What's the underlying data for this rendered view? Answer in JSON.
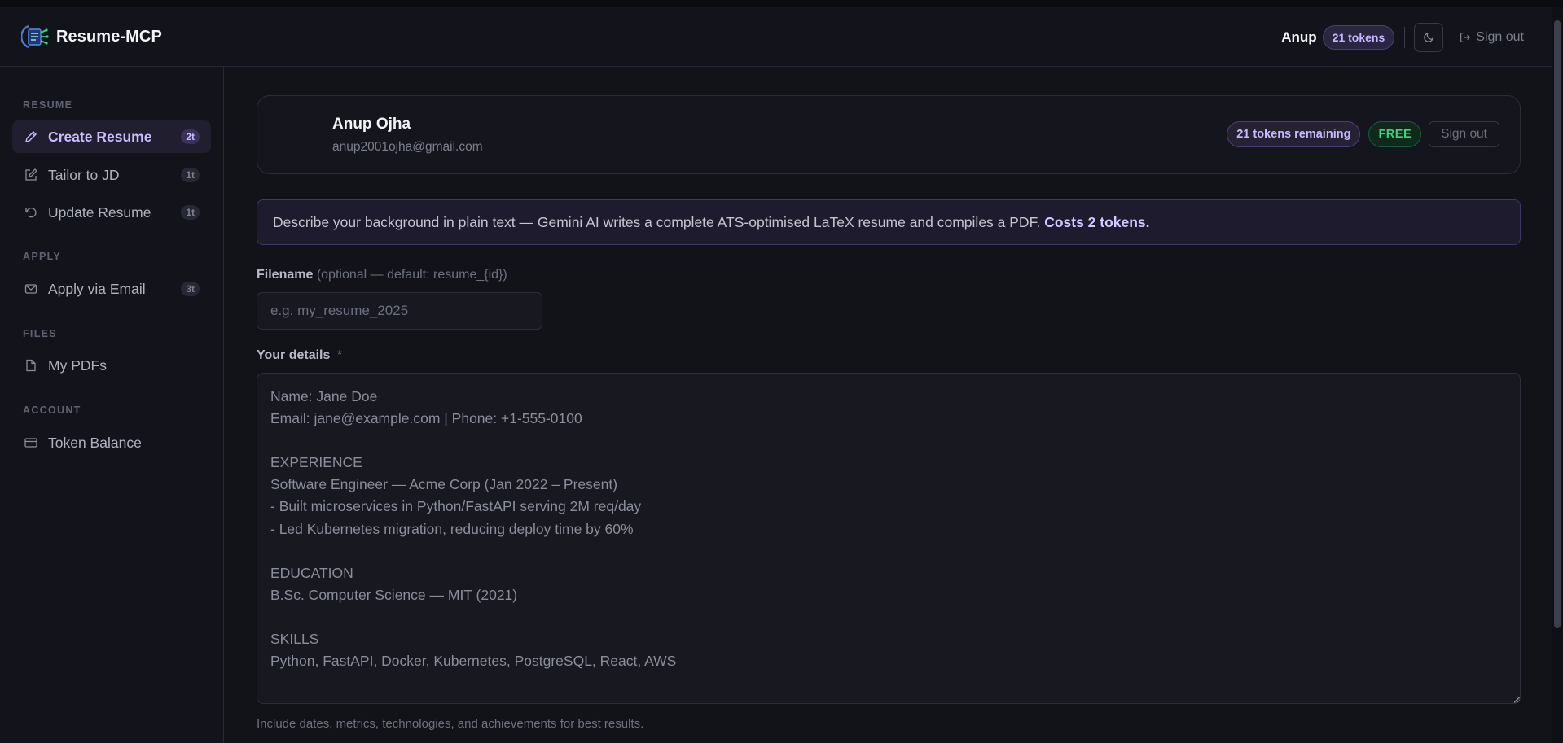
{
  "app": {
    "name": "Resume-MCP"
  },
  "header": {
    "user_name": "Anup",
    "tokens_pill": "21 tokens",
    "sign_out": "Sign out"
  },
  "sidebar": {
    "sections": [
      {
        "label": "RESUME"
      },
      {
        "label": "APPLY"
      },
      {
        "label": "FILES"
      },
      {
        "label": "ACCOUNT"
      }
    ],
    "items": [
      {
        "label": "Create Resume",
        "badge": "2t",
        "icon": "pen-icon",
        "active": true
      },
      {
        "label": "Tailor to JD",
        "badge": "1t",
        "icon": "edit-icon"
      },
      {
        "label": "Update Resume",
        "badge": "1t",
        "icon": "refresh-icon"
      },
      {
        "label": "Apply via Email",
        "badge": "3t",
        "icon": "mail-icon"
      },
      {
        "label": "My PDFs",
        "icon": "file-icon"
      },
      {
        "label": "Token Balance",
        "icon": "card-icon"
      }
    ]
  },
  "profile": {
    "name": "Anup Ojha",
    "email": "anup2001ojha@gmail.com",
    "tokens_remaining": "21 tokens remaining",
    "plan": "FREE",
    "sign_out": "Sign out"
  },
  "info": {
    "text": "Describe your background in plain text — Gemini AI writes a complete ATS-optimised LaTeX resume and compiles a PDF.",
    "cost": "Costs 2 tokens."
  },
  "form": {
    "filename_label": "Filename",
    "filename_hint": "(optional — default: resume_{id})",
    "filename_placeholder": "e.g. my_resume_2025",
    "details_label": "Your details",
    "details_required": "*",
    "details_placeholder": "Name: Jane Doe\nEmail: jane@example.com | Phone: +1-555-0100\n\nEXPERIENCE\nSoftware Engineer — Acme Corp (Jan 2022 – Present)\n- Built microservices in Python/FastAPI serving 2M req/day\n- Led Kubernetes migration, reducing deploy time by 60%\n\nEDUCATION\nB.Sc. Computer Science — MIT (2021)\n\nSKILLS\nPython, FastAPI, Docker, Kubernetes, PostgreSQL, React, AWS",
    "help_text": "Include dates, metrics, technologies, and achievements for best results."
  },
  "colors": {
    "accent": "#cbbcff",
    "background": "#121319",
    "success": "#3fd37a"
  }
}
